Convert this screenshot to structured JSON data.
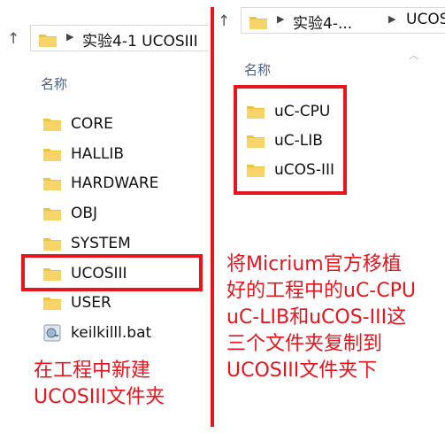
{
  "left_pane": {
    "address": "实验4-1 UCOSIII",
    "column_header": "名称",
    "items": [
      {
        "label": "CORE",
        "icon": "folder-icon"
      },
      {
        "label": "HALLIB",
        "icon": "folder-icon"
      },
      {
        "label": "HARDWARE",
        "icon": "folder-icon"
      },
      {
        "label": "OBJ",
        "icon": "folder-icon"
      },
      {
        "label": "SYSTEM",
        "icon": "folder-icon"
      },
      {
        "label": "UCOSIII",
        "icon": "folder-icon"
      },
      {
        "label": "USER",
        "icon": "folder-icon"
      },
      {
        "label": "keilkilll.bat",
        "icon": "batch-file-icon"
      }
    ]
  },
  "right_pane": {
    "address_part1": "实验4-...",
    "address_part2": "UCOSIII",
    "column_header": "名称",
    "items": [
      {
        "label": "uC-CPU",
        "icon": "folder-icon"
      },
      {
        "label": "uC-LIB",
        "icon": "folder-icon"
      },
      {
        "label": "uCOS-III",
        "icon": "folder-icon"
      }
    ]
  },
  "annotations": {
    "left": "在工程中新建\nUCOSIII文件夹",
    "right": "将Micrium官方移植\n好的工程中的uC-CPU\nuC-LIB和uCOS-III这\n三个文件夹复制到\nUCOSIII文件夹下"
  },
  "colors": {
    "annotation_red": "#e8141c",
    "folder_yellow": "#f0c238"
  }
}
